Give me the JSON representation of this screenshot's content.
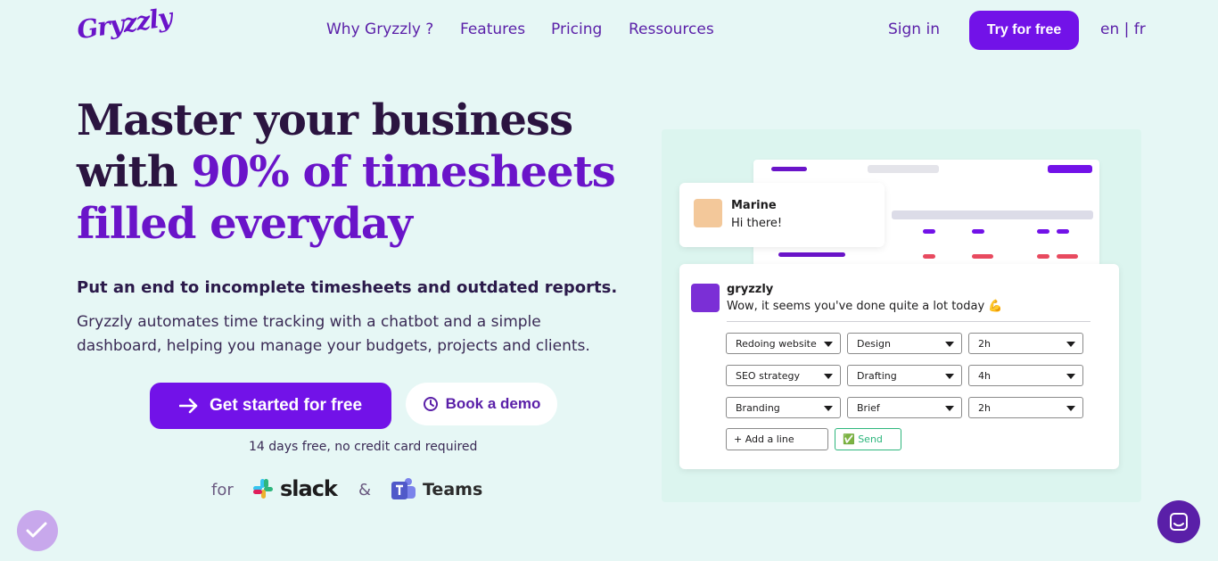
{
  "nav": {
    "logo": "Gryzzly",
    "links": [
      "Why Gryzzly ?",
      "Features",
      "Pricing",
      "Ressources"
    ],
    "sign_in": "Sign in",
    "try_free": "Try for free",
    "lang": "en | fr"
  },
  "hero": {
    "headline_part1": "Master your business with ",
    "headline_accent": "90% of timesheets filled everyday",
    "sub_bold": "Put an end to incomplete timesheets and outdated reports.",
    "sub_text": "Gryzzly automates time tracking with a chatbot and a simple dashboard, helping you manage your budgets, projects and clients.",
    "cta": "Get started for free",
    "demo": "Book a demo",
    "note": "14 days free, no credit card required",
    "for": "for",
    "slack": "slack",
    "amp": "&",
    "teams": "Teams"
  },
  "mockup": {
    "msg1": {
      "name": "Marine",
      "text": "Hi there!"
    },
    "msg2": {
      "name": "gryzzly",
      "text": "Wow, it seems you've done quite a lot today 💪",
      "rows": [
        {
          "project": "Redoing website",
          "task": "Design",
          "time": "2h"
        },
        {
          "project": "SEO strategy",
          "task": "Drafting",
          "time": "4h"
        },
        {
          "project": "Branding",
          "task": "Brief",
          "time": "2h"
        }
      ],
      "add_line": "+ Add a line",
      "send": "Send"
    }
  },
  "colors": {
    "brand": "#7212e8",
    "accent": "#6a14c9",
    "background": "#e6f7f5"
  }
}
